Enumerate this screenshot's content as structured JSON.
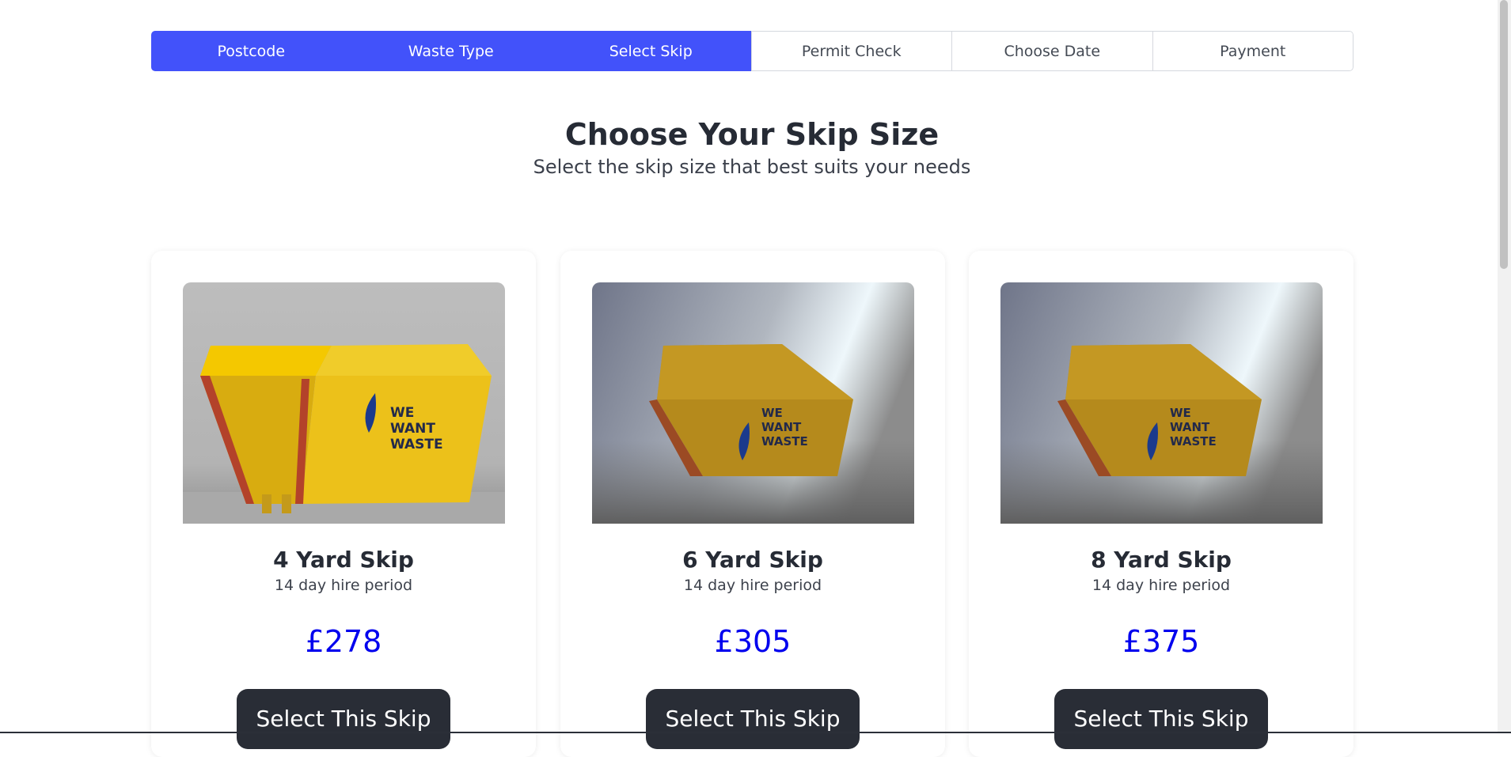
{
  "stepper": {
    "steps": [
      {
        "label": "Postcode",
        "state": "active"
      },
      {
        "label": "Waste Type",
        "state": "active"
      },
      {
        "label": "Select Skip",
        "state": "active"
      },
      {
        "label": "Permit Check",
        "state": "inactive"
      },
      {
        "label": "Choose Date",
        "state": "inactive"
      },
      {
        "label": "Payment",
        "state": "inactive"
      }
    ]
  },
  "heading": {
    "title": "Choose Your Skip Size",
    "subtitle": "Select the skip size that best suits your needs"
  },
  "skips": [
    {
      "image_icon": "yellow-skip-image",
      "image_text": "WE WANT WASTE",
      "name": "4 Yard Skip",
      "period": "14 day hire period",
      "price": "£278",
      "button": "Select This Skip"
    },
    {
      "image_icon": "yellow-skip-image",
      "image_text": "WE WANT WASTE",
      "name": "6 Yard Skip",
      "period": "14 day hire period",
      "price": "£305",
      "button": "Select This Skip"
    },
    {
      "image_icon": "yellow-skip-image",
      "image_text": "WE WANT WASTE",
      "name": "8 Yard Skip",
      "period": "14 day hire period",
      "price": "£375",
      "button": "Select This Skip"
    }
  ],
  "colors": {
    "accent": "#4252fa",
    "price": "#0000ee",
    "button_bg": "#292d36",
    "heading": "#262b35"
  }
}
